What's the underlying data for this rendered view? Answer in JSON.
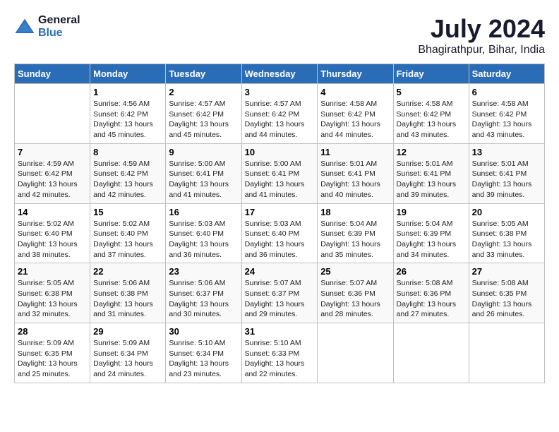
{
  "header": {
    "logo_line1": "General",
    "logo_line2": "Blue",
    "month_year": "July 2024",
    "location": "Bhagirathpur, Bihar, India"
  },
  "days_of_week": [
    "Sunday",
    "Monday",
    "Tuesday",
    "Wednesday",
    "Thursday",
    "Friday",
    "Saturday"
  ],
  "weeks": [
    [
      {
        "day": "",
        "sunrise": "",
        "sunset": "",
        "daylight": ""
      },
      {
        "day": "1",
        "sunrise": "Sunrise: 4:56 AM",
        "sunset": "Sunset: 6:42 PM",
        "daylight": "Daylight: 13 hours and 45 minutes."
      },
      {
        "day": "2",
        "sunrise": "Sunrise: 4:57 AM",
        "sunset": "Sunset: 6:42 PM",
        "daylight": "Daylight: 13 hours and 45 minutes."
      },
      {
        "day": "3",
        "sunrise": "Sunrise: 4:57 AM",
        "sunset": "Sunset: 6:42 PM",
        "daylight": "Daylight: 13 hours and 44 minutes."
      },
      {
        "day": "4",
        "sunrise": "Sunrise: 4:58 AM",
        "sunset": "Sunset: 6:42 PM",
        "daylight": "Daylight: 13 hours and 44 minutes."
      },
      {
        "day": "5",
        "sunrise": "Sunrise: 4:58 AM",
        "sunset": "Sunset: 6:42 PM",
        "daylight": "Daylight: 13 hours and 43 minutes."
      },
      {
        "day": "6",
        "sunrise": "Sunrise: 4:58 AM",
        "sunset": "Sunset: 6:42 PM",
        "daylight": "Daylight: 13 hours and 43 minutes."
      }
    ],
    [
      {
        "day": "7",
        "sunrise": "Sunrise: 4:59 AM",
        "sunset": "Sunset: 6:42 PM",
        "daylight": "Daylight: 13 hours and 42 minutes."
      },
      {
        "day": "8",
        "sunrise": "Sunrise: 4:59 AM",
        "sunset": "Sunset: 6:42 PM",
        "daylight": "Daylight: 13 hours and 42 minutes."
      },
      {
        "day": "9",
        "sunrise": "Sunrise: 5:00 AM",
        "sunset": "Sunset: 6:41 PM",
        "daylight": "Daylight: 13 hours and 41 minutes."
      },
      {
        "day": "10",
        "sunrise": "Sunrise: 5:00 AM",
        "sunset": "Sunset: 6:41 PM",
        "daylight": "Daylight: 13 hours and 41 minutes."
      },
      {
        "day": "11",
        "sunrise": "Sunrise: 5:01 AM",
        "sunset": "Sunset: 6:41 PM",
        "daylight": "Daylight: 13 hours and 40 minutes."
      },
      {
        "day": "12",
        "sunrise": "Sunrise: 5:01 AM",
        "sunset": "Sunset: 6:41 PM",
        "daylight": "Daylight: 13 hours and 39 minutes."
      },
      {
        "day": "13",
        "sunrise": "Sunrise: 5:01 AM",
        "sunset": "Sunset: 6:41 PM",
        "daylight": "Daylight: 13 hours and 39 minutes."
      }
    ],
    [
      {
        "day": "14",
        "sunrise": "Sunrise: 5:02 AM",
        "sunset": "Sunset: 6:40 PM",
        "daylight": "Daylight: 13 hours and 38 minutes."
      },
      {
        "day": "15",
        "sunrise": "Sunrise: 5:02 AM",
        "sunset": "Sunset: 6:40 PM",
        "daylight": "Daylight: 13 hours and 37 minutes."
      },
      {
        "day": "16",
        "sunrise": "Sunrise: 5:03 AM",
        "sunset": "Sunset: 6:40 PM",
        "daylight": "Daylight: 13 hours and 36 minutes."
      },
      {
        "day": "17",
        "sunrise": "Sunrise: 5:03 AM",
        "sunset": "Sunset: 6:40 PM",
        "daylight": "Daylight: 13 hours and 36 minutes."
      },
      {
        "day": "18",
        "sunrise": "Sunrise: 5:04 AM",
        "sunset": "Sunset: 6:39 PM",
        "daylight": "Daylight: 13 hours and 35 minutes."
      },
      {
        "day": "19",
        "sunrise": "Sunrise: 5:04 AM",
        "sunset": "Sunset: 6:39 PM",
        "daylight": "Daylight: 13 hours and 34 minutes."
      },
      {
        "day": "20",
        "sunrise": "Sunrise: 5:05 AM",
        "sunset": "Sunset: 6:38 PM",
        "daylight": "Daylight: 13 hours and 33 minutes."
      }
    ],
    [
      {
        "day": "21",
        "sunrise": "Sunrise: 5:05 AM",
        "sunset": "Sunset: 6:38 PM",
        "daylight": "Daylight: 13 hours and 32 minutes."
      },
      {
        "day": "22",
        "sunrise": "Sunrise: 5:06 AM",
        "sunset": "Sunset: 6:38 PM",
        "daylight": "Daylight: 13 hours and 31 minutes."
      },
      {
        "day": "23",
        "sunrise": "Sunrise: 5:06 AM",
        "sunset": "Sunset: 6:37 PM",
        "daylight": "Daylight: 13 hours and 30 minutes."
      },
      {
        "day": "24",
        "sunrise": "Sunrise: 5:07 AM",
        "sunset": "Sunset: 6:37 PM",
        "daylight": "Daylight: 13 hours and 29 minutes."
      },
      {
        "day": "25",
        "sunrise": "Sunrise: 5:07 AM",
        "sunset": "Sunset: 6:36 PM",
        "daylight": "Daylight: 13 hours and 28 minutes."
      },
      {
        "day": "26",
        "sunrise": "Sunrise: 5:08 AM",
        "sunset": "Sunset: 6:36 PM",
        "daylight": "Daylight: 13 hours and 27 minutes."
      },
      {
        "day": "27",
        "sunrise": "Sunrise: 5:08 AM",
        "sunset": "Sunset: 6:35 PM",
        "daylight": "Daylight: 13 hours and 26 minutes."
      }
    ],
    [
      {
        "day": "28",
        "sunrise": "Sunrise: 5:09 AM",
        "sunset": "Sunset: 6:35 PM",
        "daylight": "Daylight: 13 hours and 25 minutes."
      },
      {
        "day": "29",
        "sunrise": "Sunrise: 5:09 AM",
        "sunset": "Sunset: 6:34 PM",
        "daylight": "Daylight: 13 hours and 24 minutes."
      },
      {
        "day": "30",
        "sunrise": "Sunrise: 5:10 AM",
        "sunset": "Sunset: 6:34 PM",
        "daylight": "Daylight: 13 hours and 23 minutes."
      },
      {
        "day": "31",
        "sunrise": "Sunrise: 5:10 AM",
        "sunset": "Sunset: 6:33 PM",
        "daylight": "Daylight: 13 hours and 22 minutes."
      },
      {
        "day": "",
        "sunrise": "",
        "sunset": "",
        "daylight": ""
      },
      {
        "day": "",
        "sunrise": "",
        "sunset": "",
        "daylight": ""
      },
      {
        "day": "",
        "sunrise": "",
        "sunset": "",
        "daylight": ""
      }
    ]
  ]
}
